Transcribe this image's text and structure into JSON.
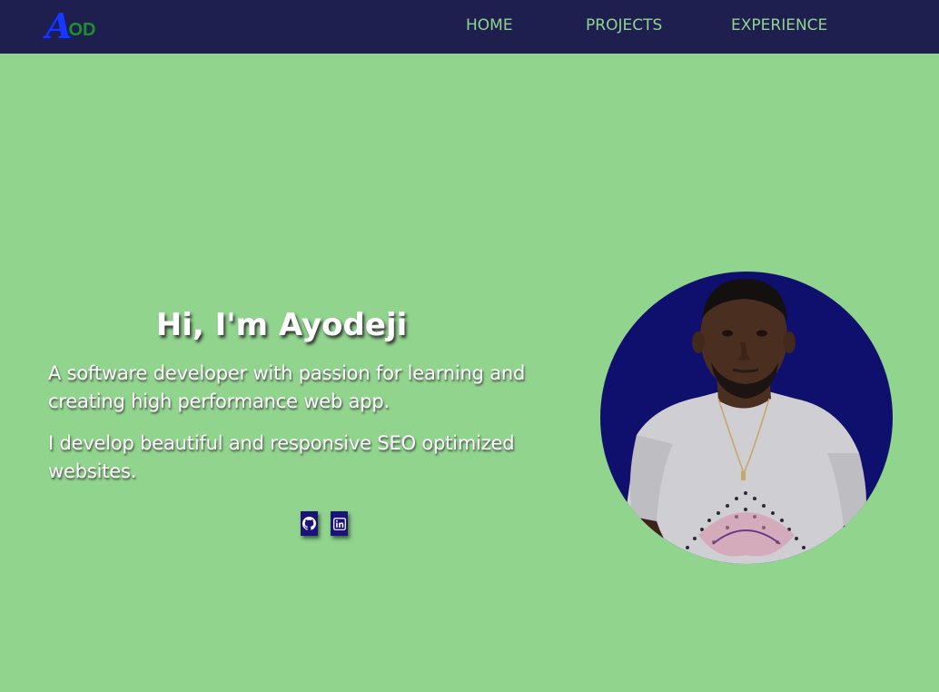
{
  "nav": {
    "logo_first": "A",
    "logo_rest": "OD",
    "links": [
      "HOME",
      "PROJECTS",
      "EXPERIENCE"
    ]
  },
  "hero": {
    "title": "Hi, I'm Ayodeji",
    "line1": "A software developer with passion for learning and creating high performance web app.",
    "line2": "I develop beautiful and responsive SEO optimized websites."
  },
  "social": {
    "icons": [
      "github-icon",
      "linkedin-icon"
    ]
  },
  "colors": {
    "navbar": "#1f1f4f",
    "background": "#90d48d",
    "nav_text": "#8fd48d",
    "avatar_bg": "#0f0f6e",
    "social_bg": "#1a1478"
  }
}
